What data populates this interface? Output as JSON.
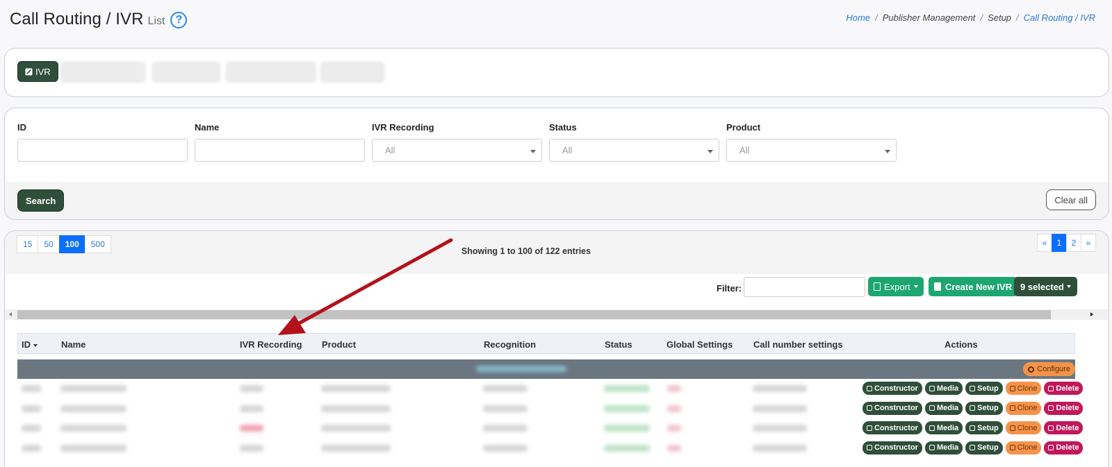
{
  "header": {
    "title": "Call Routing / IVR",
    "subtitle": "List",
    "help_glyph": "?"
  },
  "breadcrumb": {
    "items": [
      "Home",
      "Publisher Management",
      "Setup",
      "Call Routing / IVR"
    ],
    "separator": "/"
  },
  "tabs": {
    "active_label": "IVR"
  },
  "filters": {
    "id_label": "ID",
    "name_label": "Name",
    "recording_label": "IVR Recording",
    "recording_value": "All",
    "status_label": "Status",
    "status_value": "All",
    "product_label": "Product",
    "product_value": "All",
    "search_label": "Search",
    "clear_label": "Clear all"
  },
  "table_controls": {
    "page_sizes": [
      "15",
      "50",
      "100",
      "500"
    ],
    "active_page_size": "100",
    "showing_text": "Showing 1 to 100 of 122 entries",
    "pager": [
      "«",
      "1",
      "2",
      "»"
    ],
    "filter_label": "Filter:",
    "export_label": "Export",
    "create_label": "Create New IVR",
    "selected_label": "9 selected"
  },
  "table": {
    "columns": [
      "ID",
      "Name",
      "IVR Recording",
      "Product",
      "Recognition",
      "Status",
      "Global Settings",
      "Call number settings",
      "Actions"
    ],
    "group_action_label": "Configure",
    "action_labels": {
      "constructor": "Constructor",
      "media": "Media",
      "setup": "Setup",
      "clone": "Clone",
      "delete": "Delete"
    },
    "row_count": 4
  },
  "colors": {
    "accent_dark_green": "#2f4f3a",
    "accent_green": "#1ea672",
    "primary_blue": "#0d6efd",
    "clone_orange": "#f5934a",
    "delete_pink": "#c2185b",
    "arrow_red": "#b3121b"
  }
}
